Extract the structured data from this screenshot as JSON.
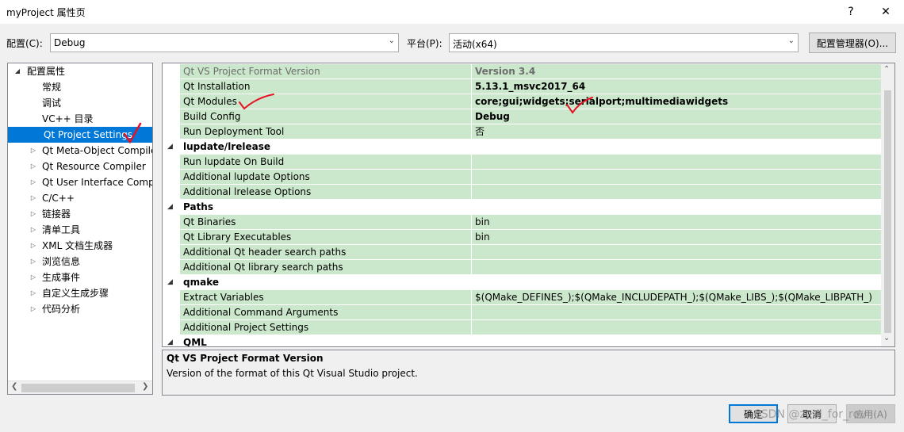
{
  "window": {
    "title": "myProject 属性页",
    "help_glyph": "?",
    "close_glyph": "✕"
  },
  "config": {
    "config_label": "配置(C):",
    "config_value": "Debug",
    "platform_label": "平台(P):",
    "platform_value": "活动(x64)",
    "manager_button": "配置管理器(O)..."
  },
  "tree": {
    "items": [
      {
        "label": "配置属性",
        "arrow": "◢",
        "indent": 0
      },
      {
        "label": "常规",
        "arrow": "",
        "indent": 1
      },
      {
        "label": "调试",
        "arrow": "",
        "indent": 1
      },
      {
        "label": "VC++ 目录",
        "arrow": "",
        "indent": 1
      },
      {
        "label": "Qt Project Settings",
        "arrow": "",
        "indent": 1,
        "selected": true
      },
      {
        "label": "Qt Meta-Object Compiler",
        "arrow": "▷",
        "indent": 1
      },
      {
        "label": "Qt Resource Compiler",
        "arrow": "▷",
        "indent": 1
      },
      {
        "label": "Qt User Interface Compiler",
        "arrow": "▷",
        "indent": 1
      },
      {
        "label": "C/C++",
        "arrow": "▷",
        "indent": 1
      },
      {
        "label": "链接器",
        "arrow": "▷",
        "indent": 1
      },
      {
        "label": "清单工具",
        "arrow": "▷",
        "indent": 1
      },
      {
        "label": "XML 文档生成器",
        "arrow": "▷",
        "indent": 1
      },
      {
        "label": "浏览信息",
        "arrow": "▷",
        "indent": 1
      },
      {
        "label": "生成事件",
        "arrow": "▷",
        "indent": 1
      },
      {
        "label": "自定义生成步骤",
        "arrow": "▷",
        "indent": 1
      },
      {
        "label": "代码分析",
        "arrow": "▷",
        "indent": 1
      }
    ]
  },
  "grid": {
    "rows": [
      {
        "type": "prop",
        "name": "Qt VS Project Format Version",
        "value": "Version 3.4",
        "style": "gray"
      },
      {
        "type": "prop",
        "name": "Qt Installation",
        "value": "5.13.1_msvc2017_64",
        "style": "bold"
      },
      {
        "type": "prop",
        "name": "Qt Modules",
        "value": "core;gui;widgets;serialport;multimediawidgets",
        "style": "bold"
      },
      {
        "type": "prop",
        "name": "Build Config",
        "value": "Debug",
        "style": "bold"
      },
      {
        "type": "prop",
        "name": "Run Deployment Tool",
        "value": "否",
        "style": ""
      },
      {
        "type": "cat",
        "name": "lupdate/lrelease"
      },
      {
        "type": "prop",
        "name": "Run lupdate On Build",
        "value": "",
        "style": ""
      },
      {
        "type": "prop",
        "name": "Additional lupdate Options",
        "value": "",
        "style": ""
      },
      {
        "type": "prop",
        "name": "Additional lrelease Options",
        "value": "",
        "style": ""
      },
      {
        "type": "cat",
        "name": "Paths"
      },
      {
        "type": "prop",
        "name": "Qt Binaries",
        "value": "bin",
        "style": ""
      },
      {
        "type": "prop",
        "name": "Qt Library Executables",
        "value": "bin",
        "style": ""
      },
      {
        "type": "prop",
        "name": "Additional Qt header search paths",
        "value": "",
        "style": ""
      },
      {
        "type": "prop",
        "name": "Additional Qt library search paths",
        "value": "",
        "style": ""
      },
      {
        "type": "cat",
        "name": "qmake"
      },
      {
        "type": "prop",
        "name": "Extract Variables",
        "value": "$(QMake_DEFINES_);$(QMake_INCLUDEPATH_);$(QMake_LIBS_);$(QMake_LIBPATH_)",
        "style": ""
      },
      {
        "type": "prop",
        "name": "Additional Command Arguments",
        "value": "",
        "style": ""
      },
      {
        "type": "prop",
        "name": "Additional Project Settings",
        "value": "",
        "style": ""
      },
      {
        "type": "cat",
        "name": "QML"
      }
    ]
  },
  "description": {
    "title": "Qt VS Project Format Version",
    "text": "Version of the format of this Qt Visual Studio project."
  },
  "buttons": {
    "ok": "确定",
    "cancel": "取消",
    "apply": "应用(A)"
  },
  "watermark": "CSDN @zeal_for_rov",
  "colors": {
    "row_green": "#cce8cc",
    "selection_blue": "#0078d7",
    "check_red": "#e81123"
  }
}
